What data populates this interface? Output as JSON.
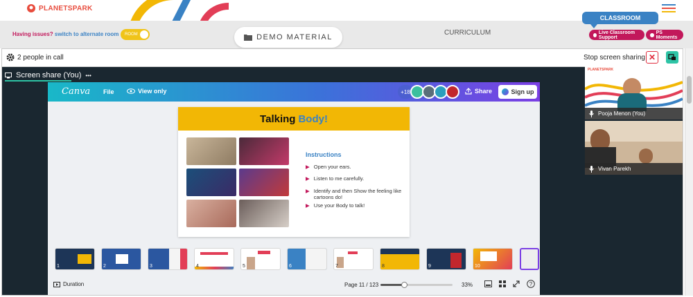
{
  "brand": {
    "logo_text": "PLANETSPARK"
  },
  "classroom_tab": "CLASSROOM",
  "issues": {
    "prefix": "Having issues?",
    "link": "switch to alternate room",
    "toggle_label": "ROOM"
  },
  "demo_material": "DEMO MATERIAL",
  "curriculum": "CURRICULUM",
  "support_buttons": {
    "live": "Live Classroom Support",
    "ps": "PS Moments"
  },
  "call": {
    "people": "2 people in call",
    "stop": "Stop screen sharing"
  },
  "share_tab": {
    "label": "Screen share (You)",
    "more": "•••"
  },
  "canva": {
    "logo": "Canva",
    "file": "File",
    "view": "View only",
    "count": "+18",
    "share": "Share",
    "signup": "Sign up"
  },
  "slide": {
    "title_a": "Talking ",
    "title_b": "Body!",
    "instructions_title": "Instructions",
    "items": [
      "Open your ears.",
      "Listen to me carefully.",
      "Identify and then Show the feeling like cartoons do!",
      "Use your Body to talk!"
    ]
  },
  "thumbnails": [
    "1",
    "2",
    "3",
    "4",
    "5",
    "6",
    "7",
    "8",
    "9",
    "10"
  ],
  "footer": {
    "duration": "Duration",
    "page": "Page 11 / 123",
    "zoom": "33%",
    "zoom_fraction": 0.33
  },
  "participants": [
    {
      "name": "Pooja Menon (You)",
      "brand": "PLANETSPARK"
    },
    {
      "name": "Vivan Parekh"
    }
  ],
  "colors": {
    "accent": "#c2185b",
    "brand_blue": "#3a82c4",
    "slide_yellow": "#f2b705",
    "danger": "#e02b3c"
  }
}
